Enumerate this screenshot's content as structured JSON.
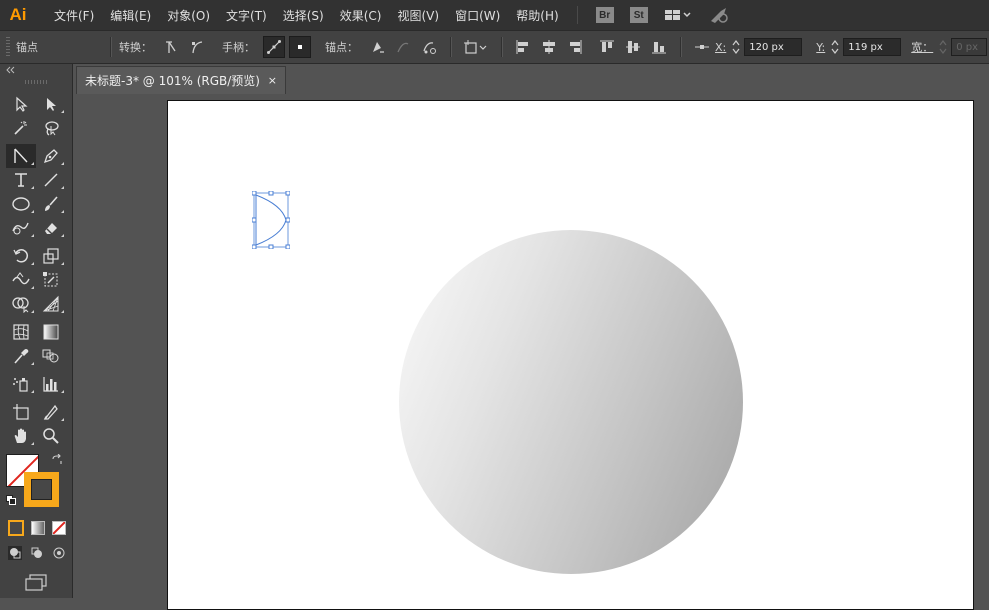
{
  "app": {
    "logo": "Ai",
    "menu": [
      "文件(F)",
      "编辑(E)",
      "对象(O)",
      "文字(T)",
      "选择(S)",
      "效果(C)",
      "视图(V)",
      "窗口(W)",
      "帮助(H)"
    ],
    "bridge_badge": "Br",
    "stock_badge": "St",
    "workspace_icon": "grid-layout-icon",
    "sync_icon": "rocket-icon"
  },
  "control_bar": {
    "context_label": "锚点",
    "convert_label": "转换：",
    "handles_label": "手柄：",
    "anchors_label": "锚点：",
    "x_label": "X:",
    "x_value": "120 px",
    "y_label": "Y:",
    "y_value": "119 px",
    "w_label": "宽：",
    "w_value": "0 px"
  },
  "document": {
    "tab_title": "未标题-3* @ 101% (RGB/预览)",
    "close_glyph": "×"
  },
  "colors": {
    "ui_dark": "#323232",
    "panel": "#424242",
    "workspace": "#535353",
    "accent_orange": "#f7a81b",
    "selection_blue": "#4a7fd4",
    "fill_swatch": "#ffffff",
    "stroke_swatch": "#474747"
  },
  "tools": [
    [
      "selection-tool",
      "direct-selection-tool"
    ],
    [
      "magic-wand-tool",
      "lasso-tool"
    ],
    [
      "line-anchor-tool",
      "pen-tool"
    ],
    [
      "type-tool",
      "line-segment-tool"
    ],
    [
      "ellipse-tool",
      "paintbrush-tool"
    ],
    [
      "shaper-tool",
      "eraser-tool"
    ],
    [
      "rotate-tool",
      "scale-tool"
    ],
    [
      "warp-tool",
      "free-transform-tool"
    ],
    [
      "shape-builder-tool",
      "perspective-grid-tool"
    ],
    [
      "mesh-tool",
      "gradient-tool"
    ],
    [
      "eyedropper-tool",
      "blend-tool"
    ],
    [
      "symbol-sprayer-tool",
      "column-graph-tool"
    ],
    [
      "artboard-tool",
      "slice-tool"
    ],
    [
      "hand-tool",
      "zoom-tool"
    ]
  ],
  "shape": {
    "fill": "radial-gray-gradient",
    "gradient_stops": [
      "#fafafa",
      "#e4e4e4",
      "#c4c4c4",
      "#a2a2a2"
    ]
  }
}
